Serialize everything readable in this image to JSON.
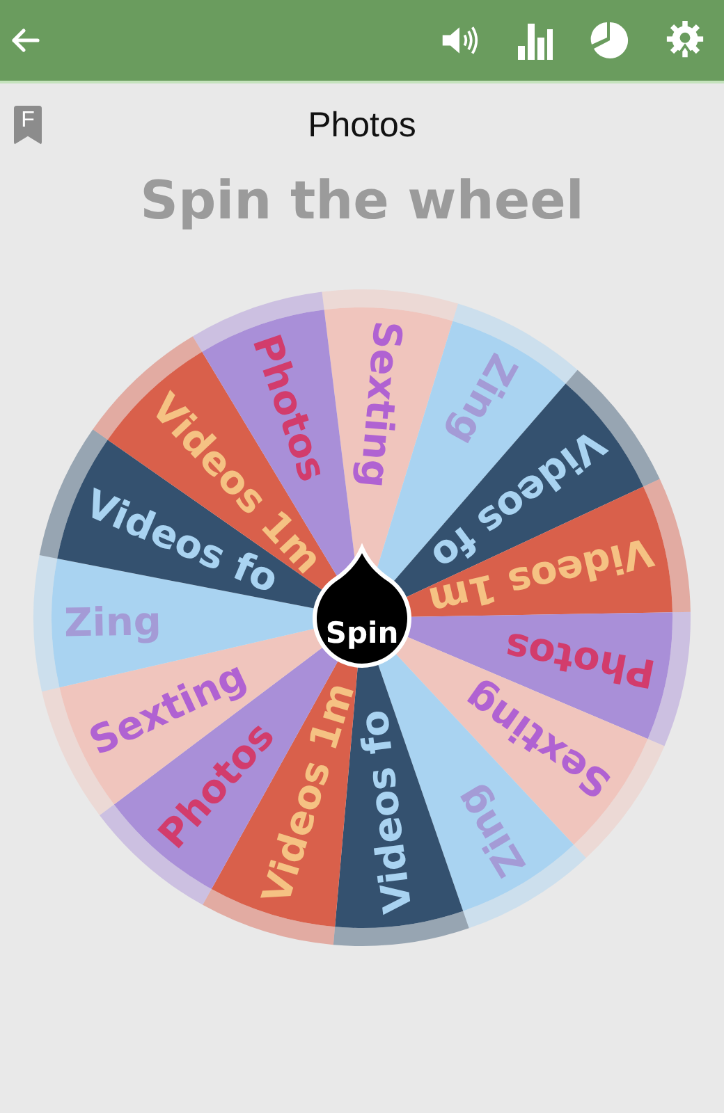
{
  "bookmark": {
    "letter": "F"
  },
  "title": "Photos",
  "heading": "Spin the wheel",
  "wheel": {
    "segments": [
      {
        "label": "Sexting",
        "color": "#f0c5bd"
      },
      {
        "label": "Zing",
        "color": "#a9d3f1"
      },
      {
        "label": "Videos fo",
        "color": "#34516f"
      },
      {
        "label": "Videos 1m",
        "color": "#d9604b"
      },
      {
        "label": "Photos",
        "color": "#a98fd8"
      },
      {
        "label": "Sexting",
        "color": "#f0c5bd"
      },
      {
        "label": "Zing",
        "color": "#a9d3f1"
      },
      {
        "label": "Videos fo",
        "color": "#34516f"
      },
      {
        "label": "Videos 1m",
        "color": "#d9604b"
      },
      {
        "label": "Photos",
        "color": "#a98fd8"
      },
      {
        "label": "Sexting",
        "color": "#f0c5bd"
      },
      {
        "label": "Zing",
        "color": "#a9d3f1"
      },
      {
        "label": "Videos fo",
        "color": "#34516f"
      },
      {
        "label": "Videos 1m",
        "color": "#d9604b"
      },
      {
        "label": "Photos",
        "color": "#a98fd8"
      }
    ],
    "spin_button": "Spin"
  }
}
